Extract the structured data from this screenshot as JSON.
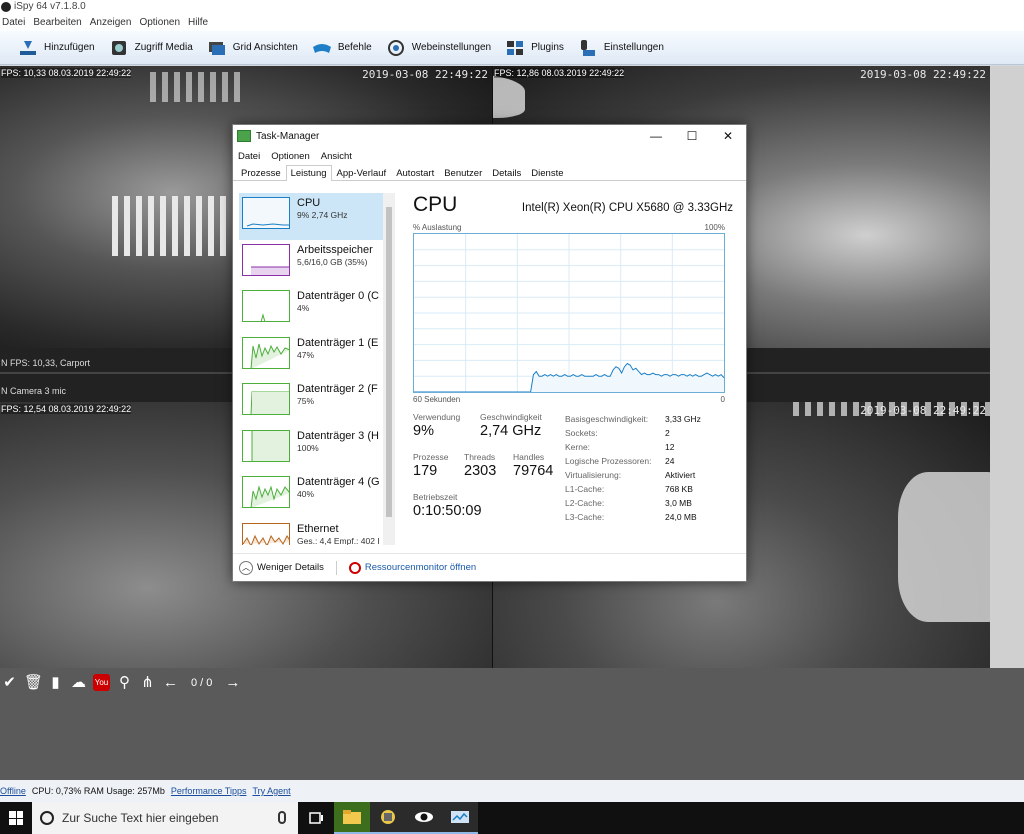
{
  "ispy": {
    "title": "iSpy 64 v7.1.8.0",
    "menu": [
      "Datei",
      "Bearbeiten",
      "Anzeigen",
      "Optionen",
      "Hilfe"
    ],
    "toolbar": [
      {
        "label": "Hinzufügen",
        "icon": "add-icon"
      },
      {
        "label": "Zugriff Media",
        "icon": "media-icon"
      },
      {
        "label": "Grid Ansichten",
        "icon": "grid-icon"
      },
      {
        "label": "Befehle",
        "icon": "commands-icon"
      },
      {
        "label": "Webeinstellungen",
        "icon": "web-settings-icon"
      },
      {
        "label": "Plugins",
        "icon": "plugins-icon"
      },
      {
        "label": "Einstellungen",
        "icon": "settings-icon"
      }
    ],
    "cameras": {
      "tl": {
        "fps": "FPS: 10,33 08.03.2019 22:49:22",
        "timestamp": "2019-03-08  22:49:22",
        "caption": "N  FPS: 10,33, Carport"
      },
      "tr": {
        "fps": "FPS: 12,86 08.03.2019 22:49:22",
        "timestamp": "2019-03-08  22:49:22"
      },
      "bl": {
        "fps": "FPS: 12,54 08.03.2019 22:49:22",
        "caption": "N  Camera 3 mic"
      },
      "br": {
        "timestamp": "2019-03-08  22:49:22"
      }
    },
    "pager": "0 / 0",
    "status": {
      "offline": "Offline",
      "usage": "CPU: 0,73% RAM Usage: 257Mb",
      "perf_tips": "Performance Tipps",
      "try_agent": "Try Agent"
    }
  },
  "taskbar": {
    "search_placeholder": "Zur Suche Text hier eingeben"
  },
  "taskmanager": {
    "title": "Task-Manager",
    "menu": [
      "Datei",
      "Optionen",
      "Ansicht"
    ],
    "tabs": [
      "Prozesse",
      "Leistung",
      "App-Verlauf",
      "Autostart",
      "Benutzer",
      "Details",
      "Dienste"
    ],
    "active_tab": "Leistung",
    "resources": [
      {
        "name": "CPU",
        "detail": "9% 2,74 GHz",
        "color": "#1a7fc4"
      },
      {
        "name": "Arbeitsspeicher",
        "detail": "5,6/16,0 GB (35%)",
        "color": "#8b2fa8"
      },
      {
        "name": "Datenträger 0 (C",
        "detail": "4%",
        "color": "#4caf3a"
      },
      {
        "name": "Datenträger 1 (E",
        "detail": "47%",
        "color": "#4caf3a"
      },
      {
        "name": "Datenträger 2 (F",
        "detail": "75%",
        "color": "#4caf3a"
      },
      {
        "name": "Datenträger 3 (H",
        "detail": "100%",
        "color": "#4caf3a"
      },
      {
        "name": "Datenträger 4 (G",
        "detail": "40%",
        "color": "#4caf3a"
      },
      {
        "name": "Ethernet",
        "detail": "Ges.: 4,4  Empf.: 402 I",
        "color": "#b5651d"
      }
    ],
    "cpu": {
      "heading": "CPU",
      "model": "Intel(R) Xeon(R) CPU X5680 @ 3.33GHz",
      "graph_top_left": "% Auslastung",
      "graph_top_right": "100%",
      "graph_bottom_left": "60 Sekunden",
      "graph_bottom_right": "0",
      "utilization": [
        0,
        0,
        0,
        0,
        0,
        0,
        0,
        0,
        0,
        0,
        0,
        0,
        0,
        0,
        0,
        0,
        0,
        0,
        0,
        0,
        0,
        0,
        0,
        0,
        0,
        0,
        0,
        0,
        0,
        0,
        0,
        0,
        0,
        0,
        0,
        0,
        0,
        0,
        0,
        0,
        0,
        0,
        11,
        13,
        10,
        10,
        11,
        10,
        11,
        10,
        11,
        10,
        10,
        11,
        10,
        10,
        11,
        10,
        10,
        11,
        10,
        10,
        10,
        10,
        11,
        10,
        10,
        11,
        10,
        10,
        14,
        16,
        15,
        12,
        16,
        18,
        17,
        14,
        15,
        13,
        11,
        12,
        11,
        11,
        12,
        11,
        11,
        10,
        11,
        11,
        10,
        11,
        11,
        10,
        11,
        11,
        10,
        11,
        10,
        11,
        10,
        10,
        11,
        12,
        11,
        10,
        11,
        10,
        11,
        9
      ],
      "labels": {
        "verwendung": "Verwendung",
        "geschwindigkeit": "Geschwindigkeit",
        "prozesse": "Prozesse",
        "threads": "Threads",
        "handles": "Handles",
        "betriebszeit": "Betriebszeit"
      },
      "values": {
        "verwendung": "9%",
        "geschwindigkeit": "2,74 GHz",
        "prozesse": "179",
        "threads": "2303",
        "handles": "79764",
        "betriebszeit": "0:10:50:09"
      },
      "details": [
        {
          "k": "Basisgeschwindigkeit:",
          "v": "3,33 GHz"
        },
        {
          "k": "Sockets:",
          "v": "2"
        },
        {
          "k": "Kerne:",
          "v": "12"
        },
        {
          "k": "Logische Prozessoren:",
          "v": "24"
        },
        {
          "k": "Virtualisierung:",
          "v": "Aktiviert"
        },
        {
          "k": "L1-Cache:",
          "v": "768 KB"
        },
        {
          "k": "L2-Cache:",
          "v": "3,0 MB"
        },
        {
          "k": "L3-Cache:",
          "v": "24,0 MB"
        }
      ]
    },
    "footer": {
      "less_details": "Weniger Details",
      "resmon": "Ressourcenmonitor öffnen"
    }
  }
}
